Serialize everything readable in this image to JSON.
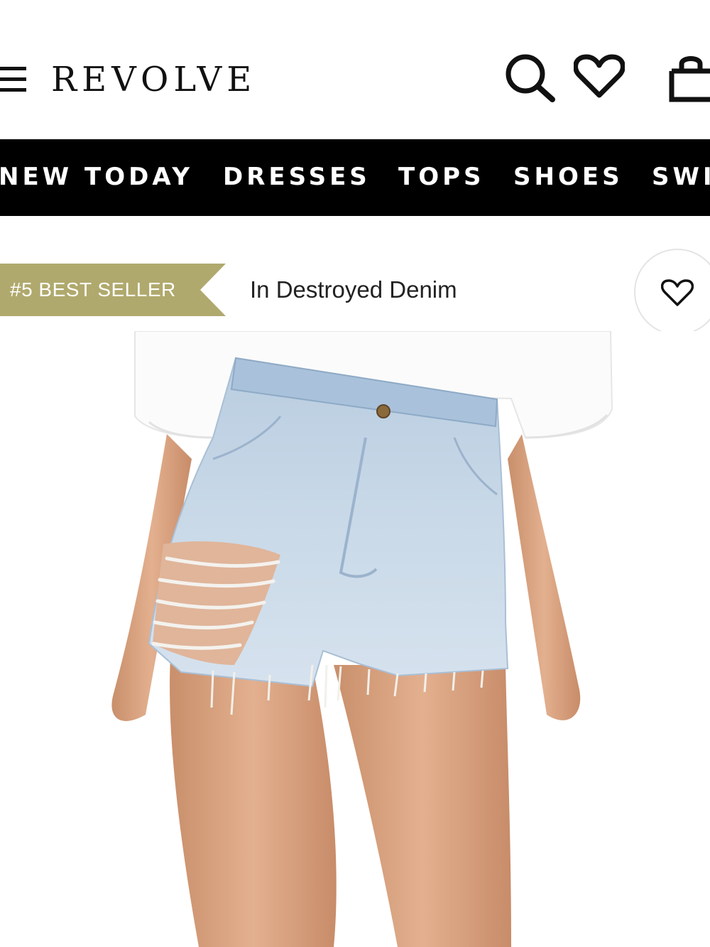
{
  "header": {
    "logo": "REVOLVE",
    "icons": [
      "menu-icon",
      "search-icon",
      "heart-icon",
      "bag-icon"
    ]
  },
  "nav": {
    "items": [
      "NEW TODAY",
      "DRESSES",
      "TOPS",
      "SHOES",
      "SWI"
    ]
  },
  "product": {
    "badge": "#5 BEST SELLER",
    "color_name": "In Destroyed Denim",
    "badge_color": "#b0a96d",
    "image_alt_icon": "product-photo"
  }
}
